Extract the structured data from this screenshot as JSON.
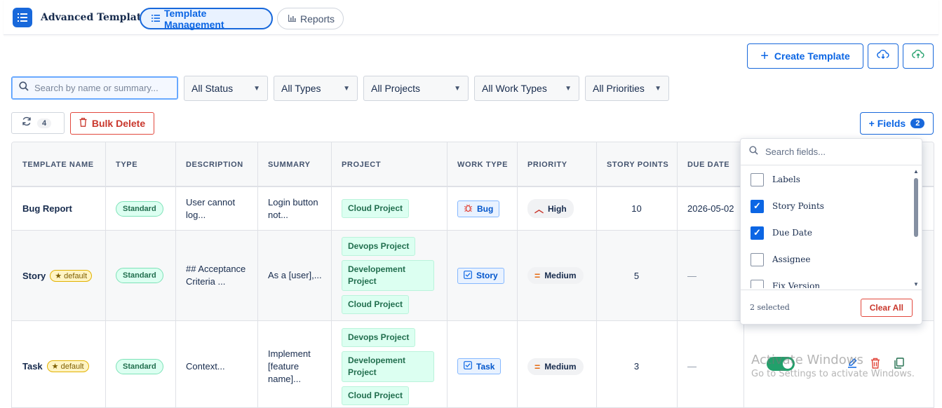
{
  "app": {
    "title": "Advanced Template",
    "logo_icon": "list-icon"
  },
  "nav": {
    "tab_template": "Template Management",
    "tab_reports": "Reports"
  },
  "toolbar": {
    "create_label": "Create Template",
    "refresh_count": "4",
    "bulk_delete_label": "Bulk Delete",
    "fields_label": "+ Fields",
    "fields_count": "2"
  },
  "filters": {
    "search_placeholder": "Search by name or summary...",
    "status": "All Status",
    "types": "All Types",
    "projects": "All Projects",
    "work_types": "All Work Types",
    "priorities": "All Priorities"
  },
  "table": {
    "headers": [
      "TEMPLATE NAME",
      "TYPE",
      "DESCRIPTION",
      "SUMMARY",
      "PROJECT",
      "WORK TYPE",
      "PRIORITY",
      "STORY POINTS",
      "DUE DATE"
    ],
    "rows": [
      {
        "name": "Bug Report",
        "default": "",
        "type": "Standard",
        "description": "User cannot log...",
        "summary": "Login button not...",
        "projects": [
          "Cloud Project"
        ],
        "work_type": "Bug",
        "priority": "High",
        "story_points": "10",
        "due_date": "2026-05-02"
      },
      {
        "name": "Story",
        "default": "★ default",
        "type": "Standard",
        "description": "## Acceptance Criteria ...",
        "summary": "As a [user],...",
        "projects": [
          "Devops Project",
          "Developement Project",
          "Cloud Project"
        ],
        "work_type": "Story",
        "priority": "Medium",
        "story_points": "5",
        "due_date": "—"
      },
      {
        "name": "Task",
        "default": "★ default",
        "type": "Standard",
        "description": "Context...",
        "summary": "Implement [feature name]...",
        "projects": [
          "Devops Project",
          "Developement Project",
          "Cloud Project"
        ],
        "work_type": "Task",
        "priority": "Medium",
        "story_points": "3",
        "due_date": "—"
      }
    ]
  },
  "fields_panel": {
    "search_placeholder": "Search fields...",
    "items": [
      {
        "label": "Labels",
        "checked": false
      },
      {
        "label": "Story Points",
        "checked": true
      },
      {
        "label": "Due Date",
        "checked": true
      },
      {
        "label": "Assignee",
        "checked": false
      },
      {
        "label": "Fix Version",
        "checked": false
      }
    ],
    "selected_text": "2 selected",
    "clear_label": "Clear All"
  },
  "watermark": {
    "line1": "Activate Windows",
    "line2": "Go to Settings to activate Windows."
  },
  "colors": {
    "primary": "#1868db",
    "danger": "#c9372c",
    "success": "#22a06b"
  }
}
